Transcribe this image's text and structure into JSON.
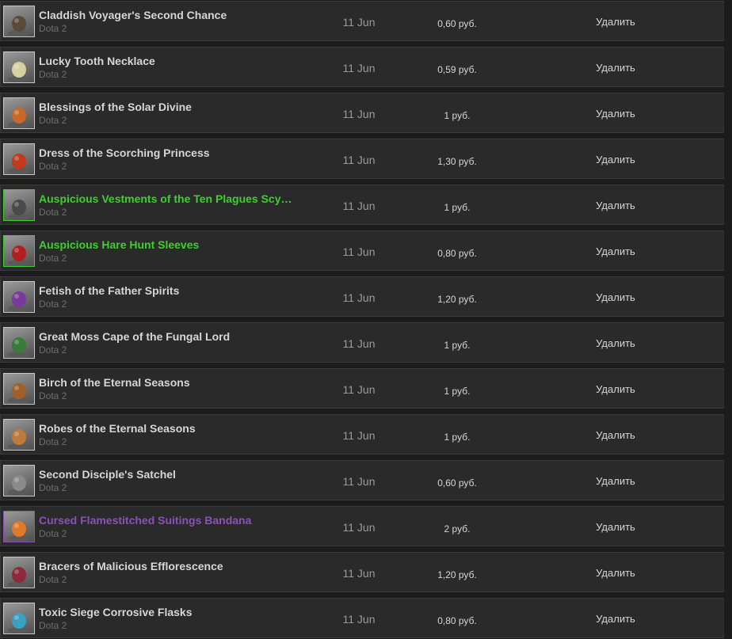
{
  "colors": {
    "normal": "#d6d6d6",
    "auspicious": "#3ecf2e",
    "cursed": "#8a52b8",
    "thumb_border_normal": "#c8c8c8",
    "thumb_border_auspicious": "#3ecf2e",
    "thumb_border_cursed": "#8a52b8"
  },
  "listings": [
    {
      "name": "Claddish Voyager's Second Chance",
      "game": "Dota 2",
      "date": "11 Jun",
      "price": "0,60 руб.",
      "action": "Удалить",
      "quality": "normal",
      "icon": "claddish-voyager-item-icon",
      "icon_color": "#5a4a3a"
    },
    {
      "name": "Lucky Tooth Necklace",
      "game": "Dota 2",
      "date": "11 Jun",
      "price": "0,59 руб.",
      "action": "Удалить",
      "quality": "normal",
      "icon": "tooth-necklace-item-icon",
      "icon_color": "#d8d0a0"
    },
    {
      "name": "Blessings of the Solar Divine",
      "game": "Dota 2",
      "date": "11 Jun",
      "price": "1 руб.",
      "action": "Удалить",
      "quality": "normal",
      "icon": "solar-divine-item-icon",
      "icon_color": "#c8692a"
    },
    {
      "name": "Dress of the Scorching Princess",
      "game": "Dota 2",
      "date": "11 Jun",
      "price": "1,30 руб.",
      "action": "Удалить",
      "quality": "normal",
      "icon": "scorching-princess-item-icon",
      "icon_color": "#c23a1e"
    },
    {
      "name": "Auspicious Vestments of the Ten Plagues Scy…",
      "game": "Dota 2",
      "date": "11 Jun",
      "price": "1 руб.",
      "action": "Удалить",
      "quality": "auspicious",
      "icon": "ten-plagues-scythe-item-icon",
      "icon_color": "#4a4a4a"
    },
    {
      "name": "Auspicious Hare Hunt Sleeves",
      "game": "Dota 2",
      "date": "11 Jun",
      "price": "0,80 руб.",
      "action": "Удалить",
      "quality": "auspicious",
      "icon": "hare-hunt-sleeves-item-icon",
      "icon_color": "#b02020"
    },
    {
      "name": "Fetish of the Father Spirits",
      "game": "Dota 2",
      "date": "11 Jun",
      "price": "1,20 руб.",
      "action": "Удалить",
      "quality": "normal",
      "icon": "father-spirits-item-icon",
      "icon_color": "#7a3a9a"
    },
    {
      "name": "Great Moss Cape of the Fungal Lord",
      "game": "Dota 2",
      "date": "11 Jun",
      "price": "1 руб.",
      "action": "Удалить",
      "quality": "normal",
      "icon": "fungal-lord-cape-item-icon",
      "icon_color": "#3a7a3a"
    },
    {
      "name": "Birch of the Eternal Seasons",
      "game": "Dota 2",
      "date": "11 Jun",
      "price": "1 руб.",
      "action": "Удалить",
      "quality": "normal",
      "icon": "eternal-seasons-birch-item-icon",
      "icon_color": "#a0602a"
    },
    {
      "name": "Robes of the Eternal Seasons",
      "game": "Dota 2",
      "date": "11 Jun",
      "price": "1 руб.",
      "action": "Удалить",
      "quality": "normal",
      "icon": "eternal-seasons-robes-item-icon",
      "icon_color": "#c07a3a"
    },
    {
      "name": "Second Disciple's Satchel",
      "game": "Dota 2",
      "date": "11 Jun",
      "price": "0,60 руб.",
      "action": "Удалить",
      "quality": "normal",
      "icon": "disciple-satchel-item-icon",
      "icon_color": "#8a8a8a"
    },
    {
      "name": "Cursed Flamestitched Suitings Bandana",
      "game": "Dota 2",
      "date": "11 Jun",
      "price": "2 руб.",
      "action": "Удалить",
      "quality": "cursed",
      "icon": "flamestitched-bandana-item-icon",
      "icon_color": "#e07a2a"
    },
    {
      "name": "Bracers of Malicious Efflorescence",
      "game": "Dota 2",
      "date": "11 Jun",
      "price": "1,20 руб.",
      "action": "Удалить",
      "quality": "normal",
      "icon": "malicious-efflorescence-bracers-item-icon",
      "icon_color": "#8a2a3a"
    },
    {
      "name": "Toxic Siege Corrosive Flasks",
      "game": "Dota 2",
      "date": "11 Jun",
      "price": "0,80 руб.",
      "action": "Удалить",
      "quality": "normal",
      "icon": "corrosive-flasks-item-icon",
      "icon_color": "#3aa0c0"
    }
  ]
}
